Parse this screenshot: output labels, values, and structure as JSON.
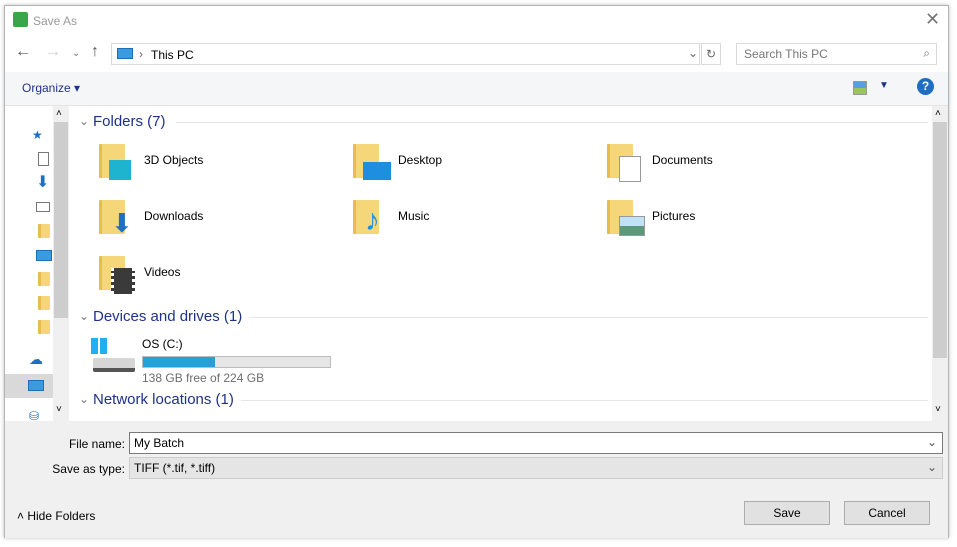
{
  "window": {
    "title": "Save As"
  },
  "nav": {
    "location": "This PC",
    "search_placeholder": "Search This PC"
  },
  "toolbar": {
    "organize": "Organize ▾"
  },
  "sections": {
    "folders": {
      "title": "Folders (7)",
      "items": [
        {
          "label": "3D Objects",
          "icon": "3d-objects-icon"
        },
        {
          "label": "Desktop",
          "icon": "desktop-icon"
        },
        {
          "label": "Documents",
          "icon": "documents-icon"
        },
        {
          "label": "Downloads",
          "icon": "downloads-icon"
        },
        {
          "label": "Music",
          "icon": "music-icon"
        },
        {
          "label": "Pictures",
          "icon": "pictures-icon"
        },
        {
          "label": "Videos",
          "icon": "videos-icon"
        }
      ]
    },
    "devices": {
      "title": "Devices and drives (1)",
      "drive": {
        "label": "OS (C:)",
        "free_text": "138 GB free of 224 GB",
        "used_percent": 38.4,
        "bar_color": "#26a0da"
      }
    },
    "network": {
      "title": "Network locations (1)"
    }
  },
  "form": {
    "file_name_label": "File name:",
    "file_name": "My Batch",
    "type_label": "Save as type:",
    "type_value": "TIFF (*.tif, *.tiff)"
  },
  "buttons": {
    "hide_folders": "Hide Folders",
    "save": "Save",
    "cancel": "Cancel"
  },
  "colors": {
    "accent": "#1e6fc2",
    "section": "#1e3287"
  }
}
